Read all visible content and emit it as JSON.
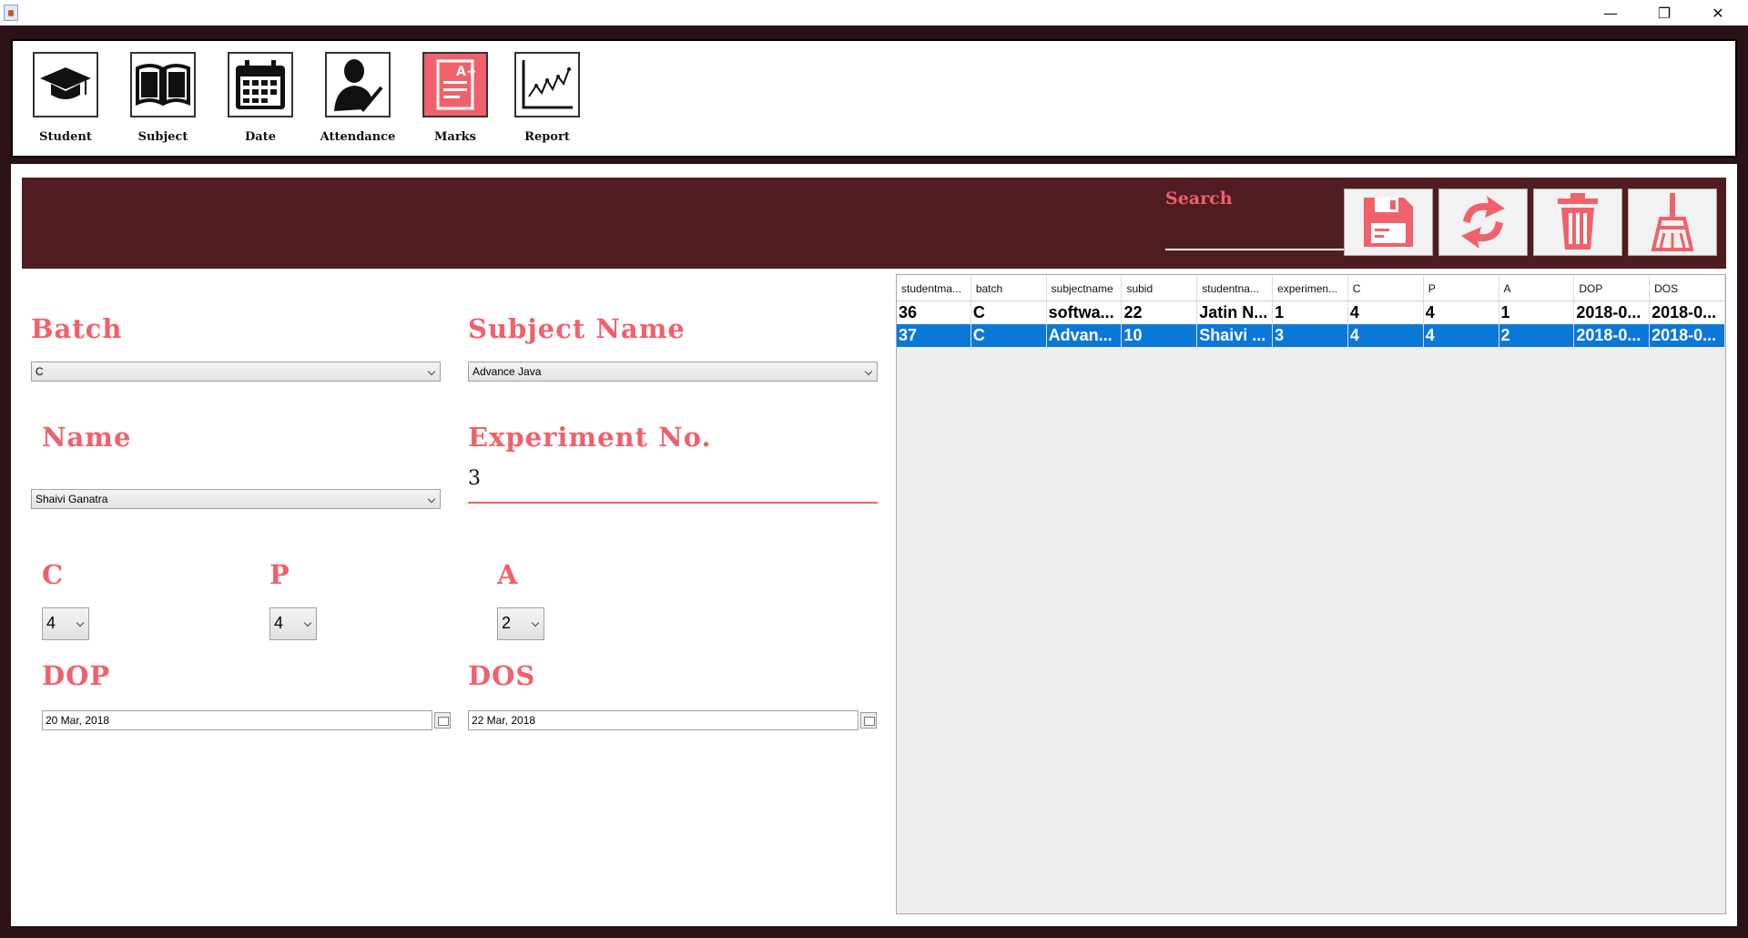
{
  "window": {
    "minimize": "—",
    "maximize": "❐",
    "close": "✕"
  },
  "toolbar": {
    "items": [
      {
        "label": "Student",
        "icon": "graduation-cap-icon"
      },
      {
        "label": "Subject",
        "icon": "book-icon"
      },
      {
        "label": "Date",
        "icon": "calendar-icon"
      },
      {
        "label": "Attendance",
        "icon": "attendance-icon"
      },
      {
        "label": "Marks",
        "icon": "marks-icon"
      },
      {
        "label": "Report",
        "icon": "report-chart-icon"
      }
    ]
  },
  "header": {
    "search_label": "Search",
    "search_value": "",
    "actions": [
      "save-icon",
      "refresh-icon",
      "delete-icon",
      "clear-broom-icon"
    ],
    "accent": "#f0616b",
    "banner_color": "#4f1c21"
  },
  "form": {
    "batch_label": "Batch",
    "batch_value": "C",
    "subject_label": "Subject Name",
    "subject_value": "Advance Java",
    "name_label": "Name",
    "name_value": "Shaivi Ganatra",
    "experiment_label": "Experiment No.",
    "experiment_value": "3",
    "c_label": "C",
    "c_value": "4",
    "p_label": "P",
    "p_value": "4",
    "a_label": "A",
    "a_value": "2",
    "dop_label": "DOP",
    "dop_value": "20 Mar, 2018",
    "dos_label": "DOS",
    "dos_value": "22 Mar, 2018"
  },
  "table": {
    "columns": [
      "studentma...",
      "batch",
      "subjectname",
      "subid",
      "studentna...",
      "experimen...",
      "C",
      "P",
      "A",
      "DOP",
      "DOS"
    ],
    "rows": [
      [
        "36",
        "C",
        "softwa...",
        "22",
        "Jatin N...",
        "1",
        "4",
        "4",
        "1",
        "2018-0...",
        "2018-0..."
      ],
      [
        "37",
        "C",
        "Advan...",
        "10",
        "Shaivi ...",
        "3",
        "4",
        "4",
        "2",
        "2018-0...",
        "2018-0..."
      ]
    ],
    "selected_row": 1
  }
}
